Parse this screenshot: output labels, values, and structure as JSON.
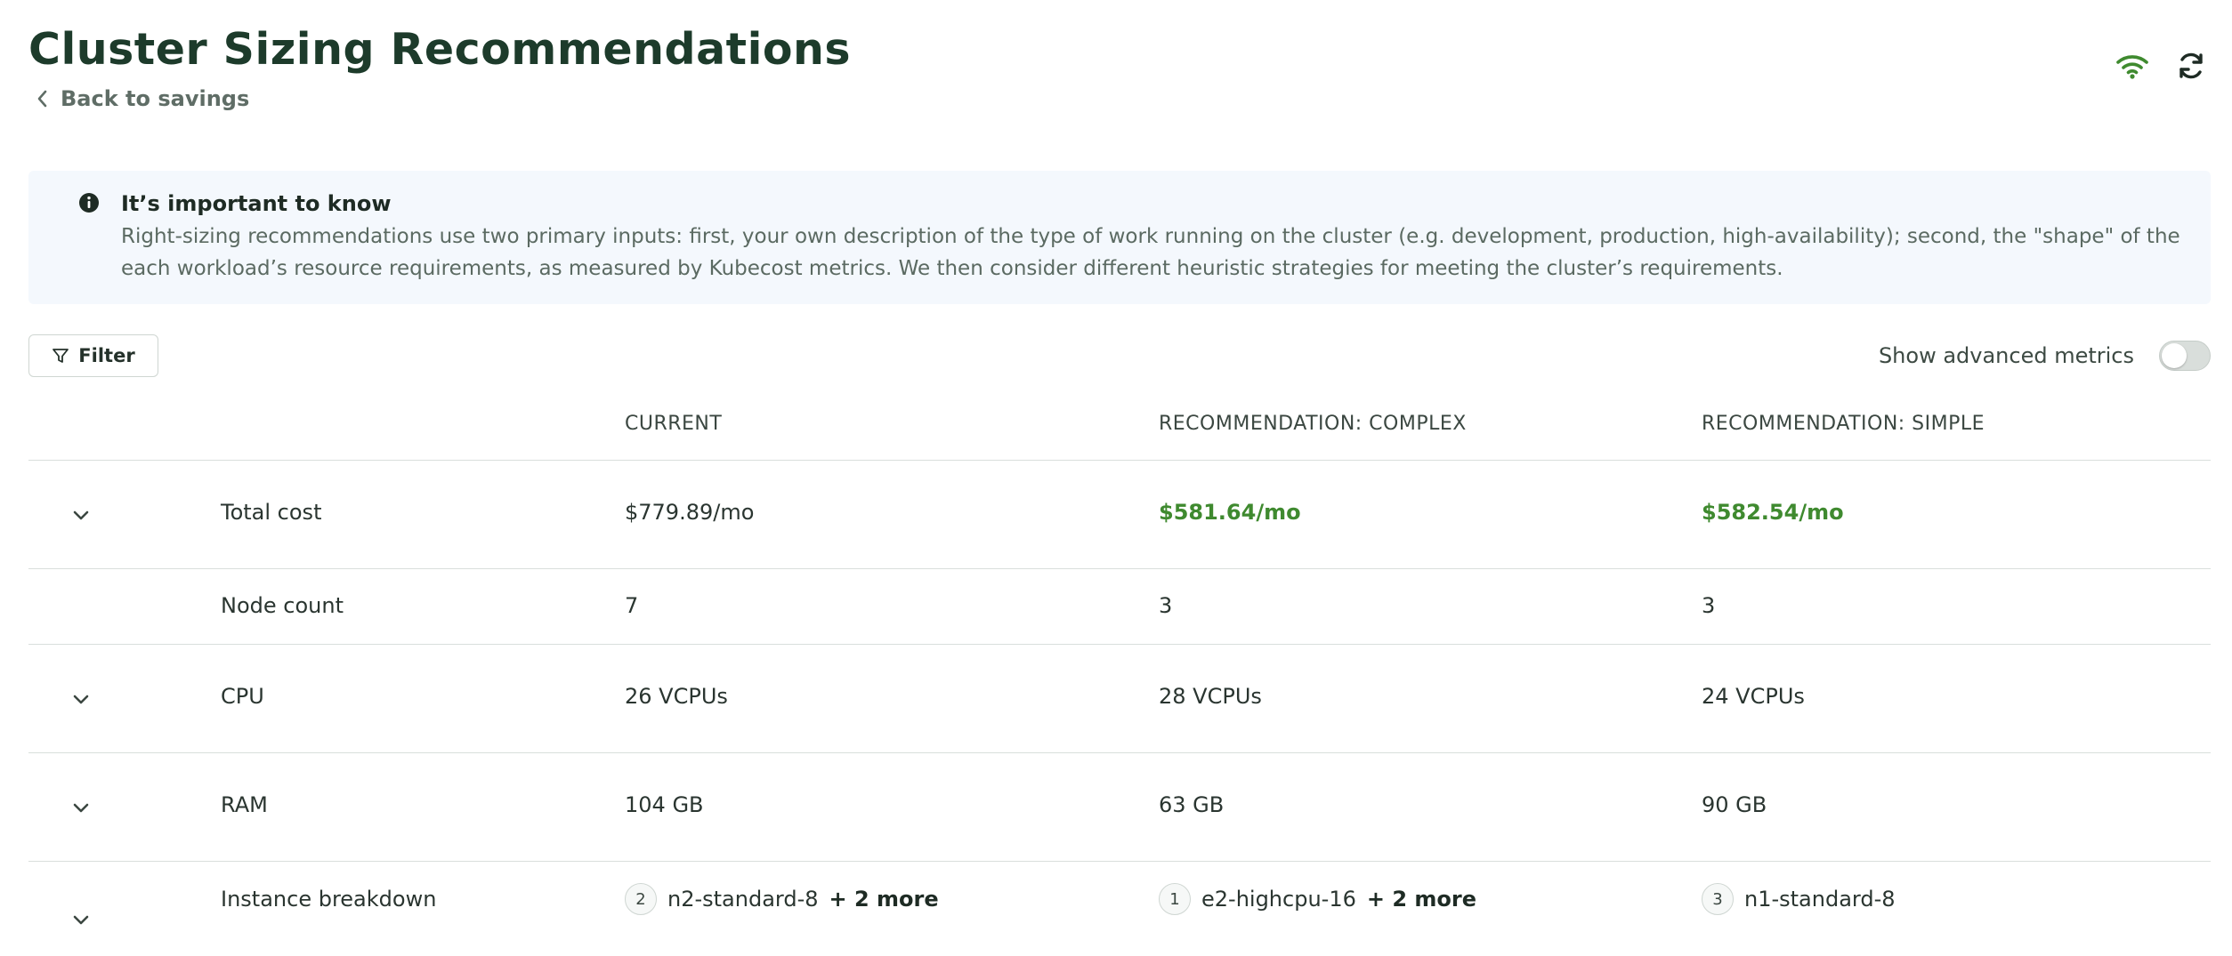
{
  "header": {
    "title": "Cluster Sizing Recommendations",
    "back_label": "Back to savings",
    "icons": [
      "wifi-icon",
      "refresh-icon"
    ],
    "accent_color": "#3f8a2f"
  },
  "info": {
    "title": "It’s important to know",
    "text": "Right-sizing recommendations use two primary inputs: first, your own description of the type of work running on the cluster (e.g. development, production, high-availability); second, the \"shape\" of the each workload’s resource requirements, as measured by Kubecost metrics. We then consider different heuristic strategies for meeting the cluster’s requirements."
  },
  "toolbar": {
    "filter_label": "Filter",
    "advanced_label": "Show advanced metrics",
    "advanced_enabled": false
  },
  "table": {
    "headers": [
      "CURRENT",
      "RECOMMENDATION: COMPLEX",
      "RECOMMENDATION: SIMPLE"
    ],
    "rows": {
      "total_cost": {
        "label": "Total cost",
        "current": "$779.89/mo",
        "complex": "$581.64/mo",
        "simple": "$582.54/mo"
      },
      "node_count": {
        "label": "Node count",
        "current": "7",
        "complex": "3",
        "simple": "3"
      },
      "cpu": {
        "label": "CPU",
        "current": "26 VCPUs",
        "complex": "28 VCPUs",
        "simple": "24 VCPUs"
      },
      "ram": {
        "label": "RAM",
        "current": "104 GB",
        "complex": "63 GB",
        "simple": "90 GB"
      },
      "instances": {
        "label": "Instance breakdown",
        "current": {
          "count": "2",
          "type": "n2-standard-8",
          "more": "+ 2 more"
        },
        "complex": {
          "count": "1",
          "type": "e2-highcpu-16",
          "more": "+ 2 more"
        },
        "simple": {
          "count": "3",
          "type": "n1-standard-8"
        }
      }
    }
  }
}
